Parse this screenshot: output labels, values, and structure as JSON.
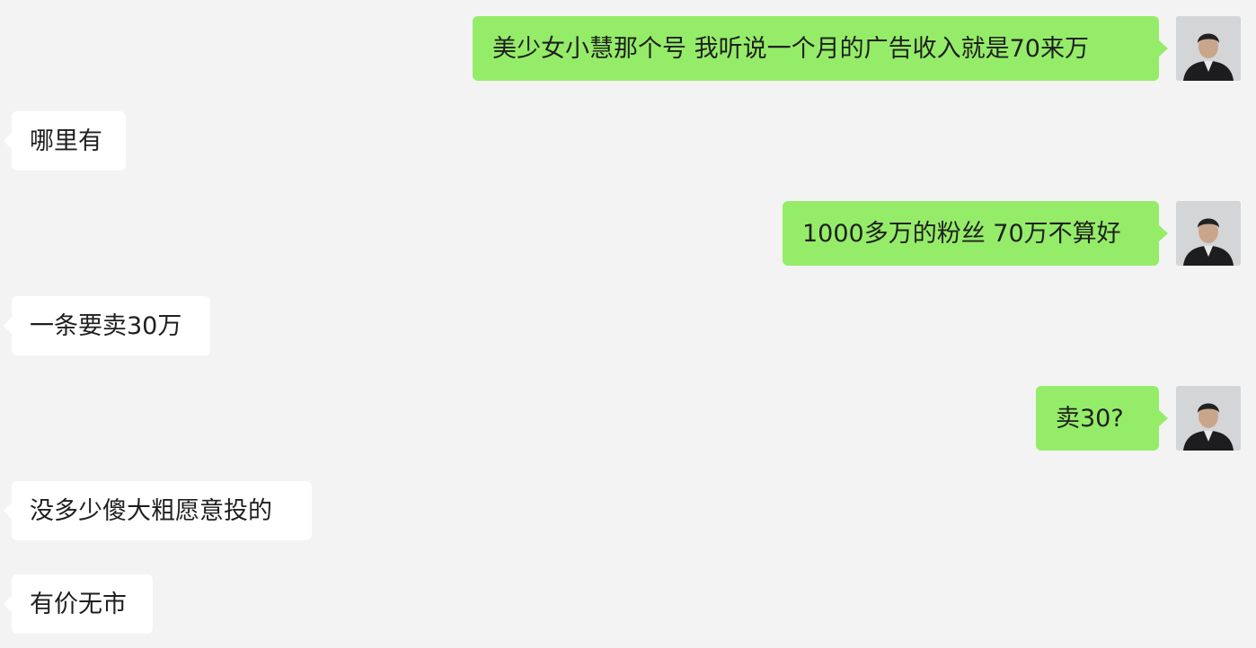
{
  "chat": {
    "messages": [
      {
        "side": "out",
        "text": "美少女小慧那个号 我听说一个月的广告收入就是70来万",
        "avatar": "person-in-suit"
      },
      {
        "side": "in",
        "text": "哪里有"
      },
      {
        "side": "out",
        "text": "1000多万的粉丝 70万不算好",
        "avatar": "person-in-suit"
      },
      {
        "side": "in",
        "text": "一条要卖30万"
      },
      {
        "side": "out",
        "text": "卖30?",
        "avatar": "person-in-suit"
      },
      {
        "side": "in",
        "text": "没多少傻大粗愿意投的"
      },
      {
        "side": "in",
        "text": "有价无市"
      }
    ]
  },
  "colors": {
    "background": "#f3f3f3",
    "outgoing_bubble": "#95ec69",
    "incoming_bubble": "#ffffff",
    "text": "#1f1f1f"
  }
}
